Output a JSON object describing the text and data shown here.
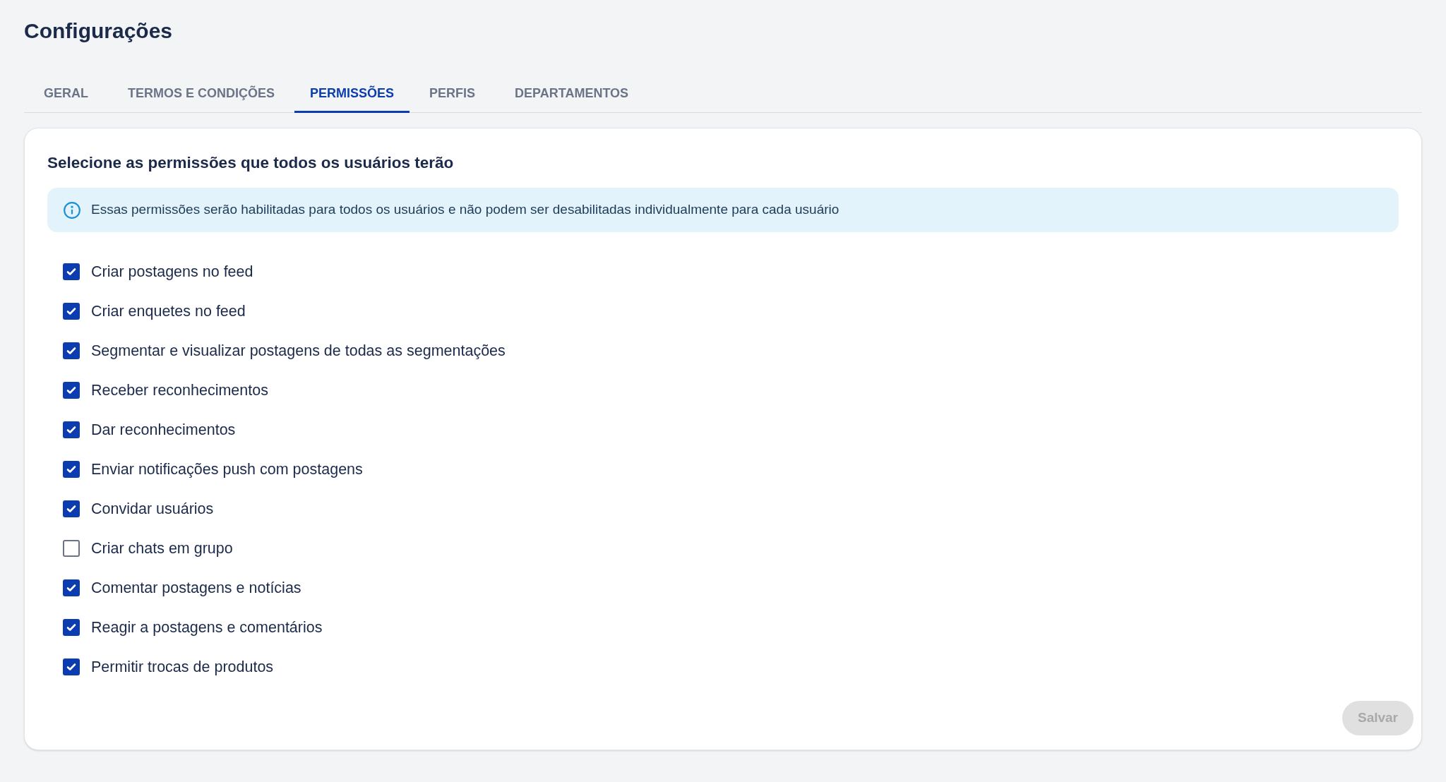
{
  "page": {
    "title": "Configurações"
  },
  "tabs": [
    {
      "label": "GERAL",
      "selected": false
    },
    {
      "label": "TERMOS E CONDIÇÕES",
      "selected": false
    },
    {
      "label": "PERMISSÕES",
      "selected": true
    },
    {
      "label": "PERFIS",
      "selected": false
    },
    {
      "label": "DEPARTAMENTOS",
      "selected": false
    }
  ],
  "card": {
    "heading": "Selecione as permissões que todos os usuários terão",
    "info": "Essas permissões serão habilitadas para todos os usuários e não podem ser desabilitadas individualmente para cada usuário",
    "permissions": [
      {
        "label": "Criar postagens no feed",
        "checked": true
      },
      {
        "label": "Criar enquetes no feed",
        "checked": true
      },
      {
        "label": "Segmentar e visualizar postagens de todas as segmentações",
        "checked": true
      },
      {
        "label": "Receber reconhecimentos",
        "checked": true
      },
      {
        "label": "Dar reconhecimentos",
        "checked": true
      },
      {
        "label": "Enviar notificações push com postagens",
        "checked": true
      },
      {
        "label": "Convidar usuários",
        "checked": true
      },
      {
        "label": "Criar chats em grupo",
        "checked": false
      },
      {
        "label": "Comentar postagens e notícias",
        "checked": true
      },
      {
        "label": "Reagir a postagens e comentários",
        "checked": true
      },
      {
        "label": "Permitir trocas de produtos",
        "checked": true
      }
    ],
    "save_button": {
      "label": "Salvar",
      "disabled": true
    }
  }
}
